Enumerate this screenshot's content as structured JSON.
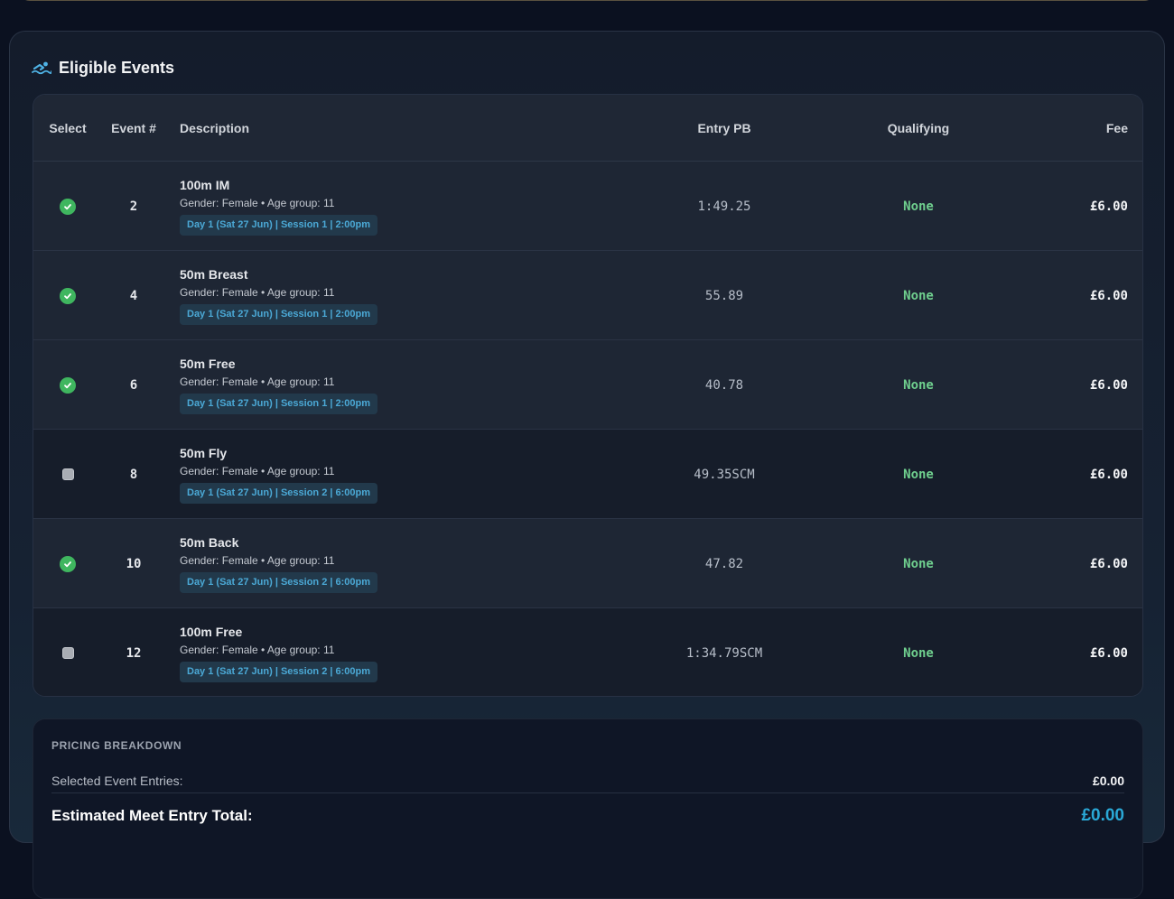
{
  "section": {
    "title": "Eligible Events",
    "icon": "swimmer-icon"
  },
  "table": {
    "headers": {
      "select": "Select",
      "event": "Event #",
      "description": "Description",
      "entry_pb": "Entry PB",
      "qualifying": "Qualifying",
      "fee": "Fee"
    },
    "rows": [
      {
        "selected": true,
        "event": "2",
        "name": "100m IM",
        "meta": "Gender: Female • Age group: 11",
        "session": "Day 1 (Sat 27 Jun) | Session 1 | 2:00pm",
        "pb": "1:49.25",
        "qualifying": "None",
        "fee": "£6.00"
      },
      {
        "selected": true,
        "event": "4",
        "name": "50m Breast",
        "meta": "Gender: Female • Age group: 11",
        "session": "Day 1 (Sat 27 Jun) | Session 1 | 2:00pm",
        "pb": "55.89",
        "qualifying": "None",
        "fee": "£6.00"
      },
      {
        "selected": true,
        "event": "6",
        "name": "50m Free",
        "meta": "Gender: Female • Age group: 11",
        "session": "Day 1 (Sat 27 Jun) | Session 1 | 2:00pm",
        "pb": "40.78",
        "qualifying": "None",
        "fee": "£6.00"
      },
      {
        "selected": false,
        "event": "8",
        "name": "50m Fly",
        "meta": "Gender: Female • Age group: 11",
        "session": "Day 1 (Sat 27 Jun) | Session 2 | 6:00pm",
        "pb": "49.35SCM",
        "qualifying": "None",
        "fee": "£6.00"
      },
      {
        "selected": true,
        "event": "10",
        "name": "50m Back",
        "meta": "Gender: Female • Age group: 11",
        "session": "Day 1 (Sat 27 Jun) | Session 2 | 6:00pm",
        "pb": "47.82",
        "qualifying": "None",
        "fee": "£6.00"
      },
      {
        "selected": false,
        "event": "12",
        "name": "100m Free",
        "meta": "Gender: Female • Age group: 11",
        "session": "Day 1 (Sat 27 Jun) | Session 2 | 6:00pm",
        "pb": "1:34.79SCM",
        "qualifying": "None",
        "fee": "£6.00"
      }
    ]
  },
  "pricing": {
    "title": "PRICING BREAKDOWN",
    "selected_label": "Selected Event Entries:",
    "selected_value": "£0.00",
    "total_label": "Estimated Meet Entry Total:",
    "total_value": "£0.00"
  },
  "colors": {
    "accent": "#2aa8d6",
    "selected_check": "#3fb65f",
    "qualifying": "#6fcf8e"
  }
}
